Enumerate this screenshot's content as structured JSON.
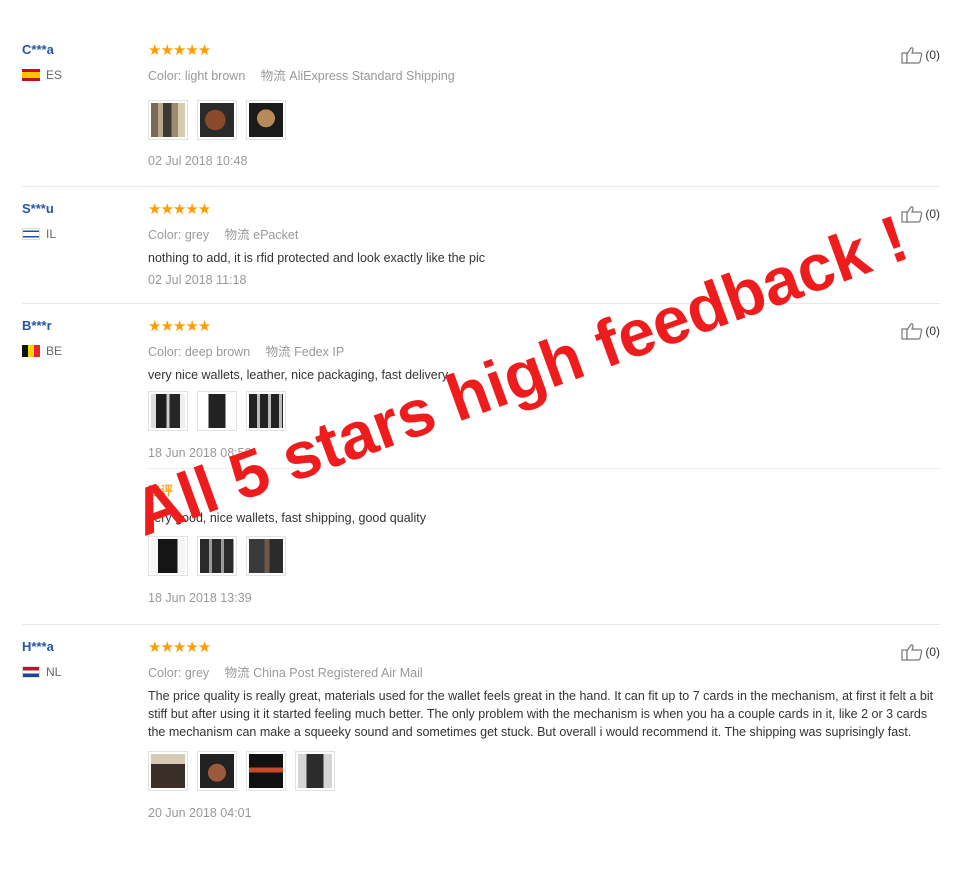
{
  "reviews": [
    {
      "user": "C***a",
      "country": "ES",
      "stars": "★★★★★",
      "color_label": "Color:",
      "color_value": "light brown",
      "ship_label": "物流",
      "ship_value": "AliExpress Standard Shipping",
      "date": "02 Jul 2018 10:48",
      "likes": "(0)"
    },
    {
      "user": "S***u",
      "country": "IL",
      "stars": "★★★★★",
      "color_label": "Color:",
      "color_value": "grey",
      "ship_label": "物流",
      "ship_value": "ePacket",
      "text": "nothing to add, it is rfid protected and look exactly like the pic",
      "date": "02 Jul 2018 11:18",
      "likes": "(0)"
    },
    {
      "user": "B***r",
      "country": "BE",
      "stars": "★★★★★",
      "color_label": "Color:",
      "color_value": "deep brown",
      "ship_label": "物流",
      "ship_value": "Fedex IP",
      "text": "very nice wallets, leather, nice packaging, fast delivery.",
      "date": "18 Jun 2018 08:59",
      "likes": "(0)",
      "append_label": "追评",
      "append_text": "very good, nice wallets, fast shipping, good quality",
      "append_date": "18 Jun 2018 13:39"
    },
    {
      "user": "H***a",
      "country": "NL",
      "stars": "★★★★★",
      "color_label": "Color:",
      "color_value": "grey",
      "ship_label": "物流",
      "ship_value": "China Post Registered Air Mail",
      "text": "The price quality is really great, materials used for the wallet feels great in the hand. It can fit up to 7 cards in the mechanism, at first it felt a bit stiff but after using it it started feeling much better. The only problem with the mechanism is when you ha a couple cards in it, like 2 or 3 cards the mechanism can make a squeeky sound and sometimes get stuck. But overall i would recommend it. The shipping was suprisingly fast.",
      "date": "20 Jun 2018 04:01",
      "likes": "(0)"
    }
  ],
  "overlay_text": "All 5 stars high feedback !",
  "colors": {
    "stars": "#ff9c00",
    "username": "#2456a4",
    "overlay": "#ee1c1c",
    "append_label": "#f5a623"
  }
}
